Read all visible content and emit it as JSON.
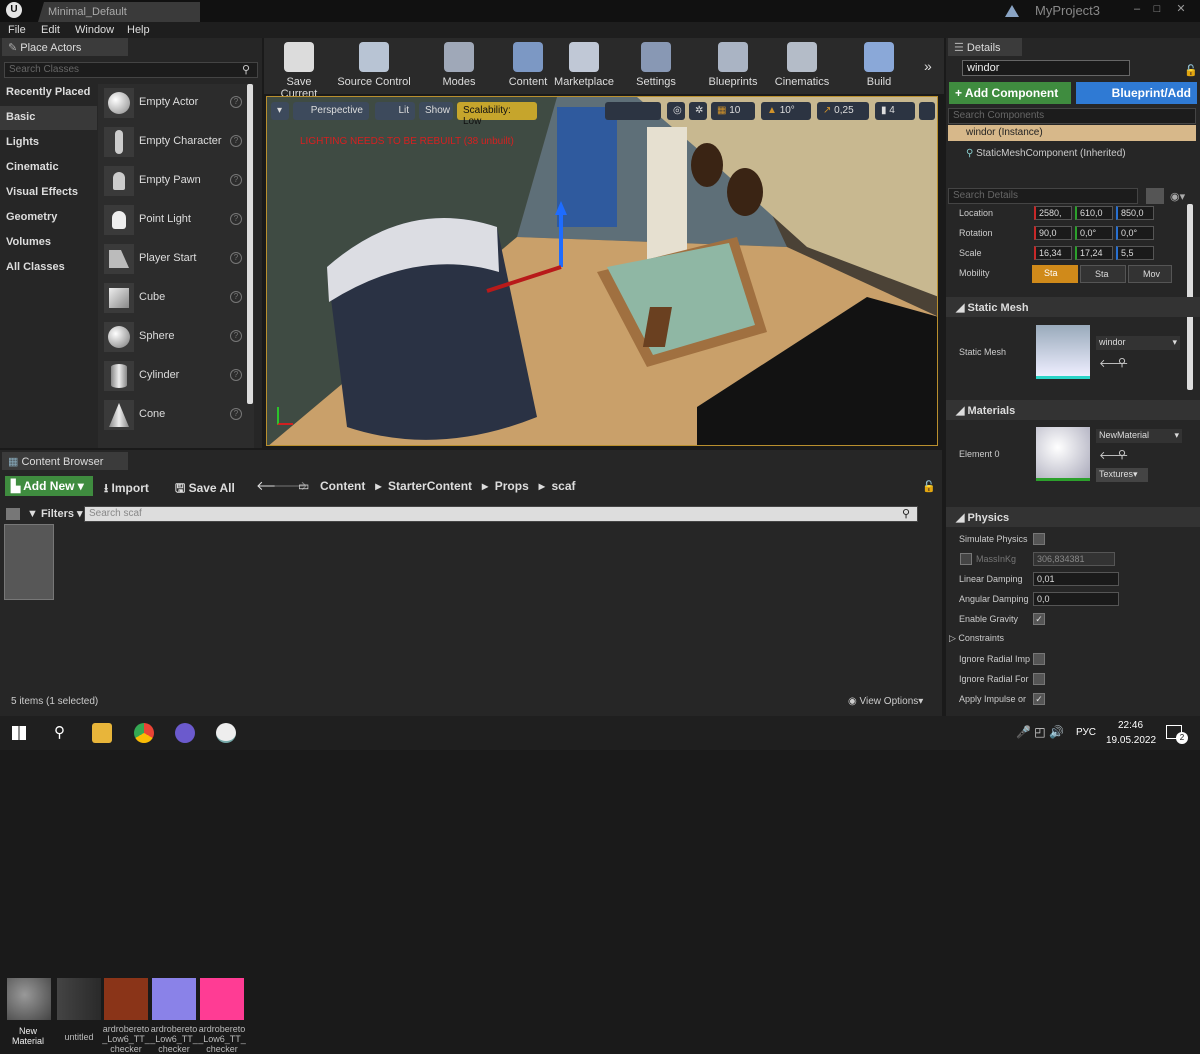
{
  "window": {
    "tab": "Minimal_Default",
    "project": "MyProject3"
  },
  "menu": [
    "File",
    "Edit",
    "Window",
    "Help"
  ],
  "place_actors": {
    "tab": "Place Actors",
    "search_placeholder": "Search Classes",
    "categories": [
      "Recently Placed",
      "Basic",
      "Lights",
      "Cinematic",
      "Visual Effects",
      "Geometry",
      "Volumes",
      "All Classes"
    ],
    "items": [
      "Empty Actor",
      "Empty Character",
      "Empty Pawn",
      "Point Light",
      "Player Start",
      "Cube",
      "Sphere",
      "Cylinder",
      "Cone"
    ]
  },
  "toolbar": [
    "Save Current",
    "Source Control",
    "Modes",
    "Content",
    "Marketplace",
    "Settings",
    "Blueprints",
    "Cinematics",
    "Build"
  ],
  "viewport": {
    "perspective": "Perspective",
    "lit": "Lit",
    "show": "Show",
    "scalability": "Scalability: Low",
    "warning": "LIGHTING NEEDS TO BE REBUILT (38 unbuilt)",
    "grid": "10",
    "angle": "10°",
    "scale": "0,25",
    "cam": "4"
  },
  "details": {
    "tab": "Details",
    "name": "windor",
    "add_component": "+ Add Component",
    "blueprint": "Blueprint/Add",
    "search_components": "Search Components",
    "instance": "windor (Instance)",
    "component": "StaticMeshComponent (Inherited)",
    "search_details": "Search Details",
    "location_label": "Location",
    "location": [
      "2580,",
      "610,0",
      "850,0"
    ],
    "rotation_label": "Rotation",
    "rotation": [
      "90,0",
      "0,0°",
      "0,0°"
    ],
    "scale_label": "Scale",
    "scale": [
      "16,34",
      "17,24",
      "5,5"
    ],
    "mobility_label": "Mobility",
    "mobility": [
      "Sta",
      "Sta",
      "Mov"
    ],
    "static_mesh_section": "Static Mesh",
    "static_mesh_label": "Static Mesh",
    "static_mesh_value": "windor",
    "materials_section": "Materials",
    "element0": "Element 0",
    "material_value": "NewMaterial",
    "textures": "Textures",
    "physics_section": "Physics",
    "simulate": "Simulate Physics",
    "mass_label": "MassInKg",
    "mass": "306,834381",
    "linear_label": "Linear Damping",
    "linear": "0,01",
    "angular_label": "Angular Damping",
    "angular": "0,0",
    "gravity_label": "Enable Gravity",
    "constraints": "Constraints",
    "radial_imp": "Ignore Radial Imp",
    "radial_for": "Ignore Radial For",
    "apply_impulse": "Apply Impulse or"
  },
  "content_browser": {
    "tab": "Content Browser",
    "add_new": "Add New",
    "import": "Import",
    "save_all": "Save All",
    "path": [
      "Content",
      "StarterContent",
      "Props",
      "scaf"
    ],
    "filters": "Filters",
    "search_placeholder": "Search scaf",
    "assets": [
      {
        "name": "New Material",
        "color": "#6a6a6a"
      },
      {
        "name": "untitled",
        "color": "#3a3a3a"
      },
      {
        "name": "ardrobereto _Low6_TT_ checker",
        "color": "#8a3418"
      },
      {
        "name": "ardrobereto _Low6_TT_ checker",
        "color": "#8a82e8"
      },
      {
        "name": "ardrobereto _Low6_TT_ checker",
        "color": "#ff3c94"
      }
    ],
    "status": "5 items (1 selected)",
    "view_options": "View Options"
  },
  "taskbar": {
    "lang": "РУС",
    "time": "22:46",
    "date": "19.05.2022",
    "notif": "2"
  }
}
